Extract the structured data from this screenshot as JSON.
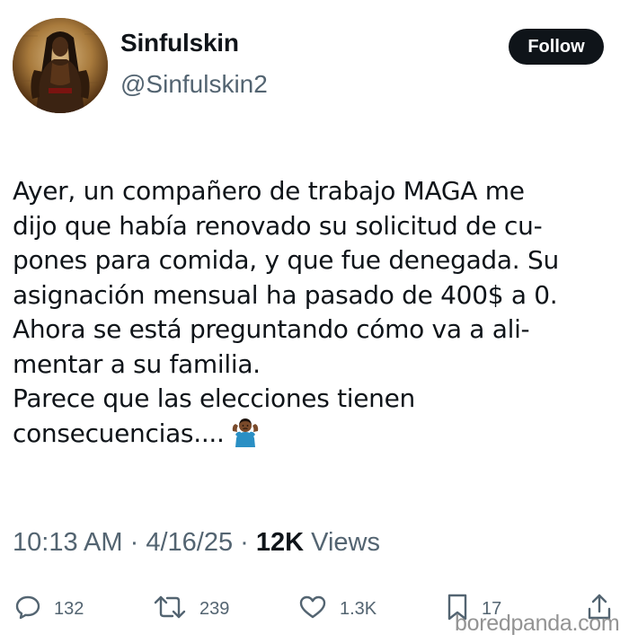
{
  "author": {
    "display_name": "Sinfulskin",
    "handle": "@Sinfulskin2",
    "follow_label": "Follow"
  },
  "tweet": {
    "lines": [
      "Ayer, un compañero de trabajo MAGA me",
      "dijo que había renovado su solicitud de cu-",
      "pones para comida, y que fue denegada. Su",
      "asignación mensual ha pasado de 400$ a 0.",
      "Ahora se está preguntando cómo va a ali-",
      "mentar a su familia.",
      "Parece que las elecciones tienen",
      "consecuencias...."
    ],
    "emoji": "shrug-emoji"
  },
  "meta": {
    "time": "10:13 AM",
    "separator": "·",
    "date": "4/16/25",
    "views_count": "12K",
    "views_label": "Views"
  },
  "actions": {
    "replies": "132",
    "reposts": "239",
    "likes": "1.3K",
    "bookmarks": "17"
  },
  "watermark": "boredpanda.com",
  "colors": {
    "text_primary": "#0f1419",
    "text_secondary": "#536471",
    "follow_bg": "#0f1419",
    "follow_text": "#ffffff"
  }
}
